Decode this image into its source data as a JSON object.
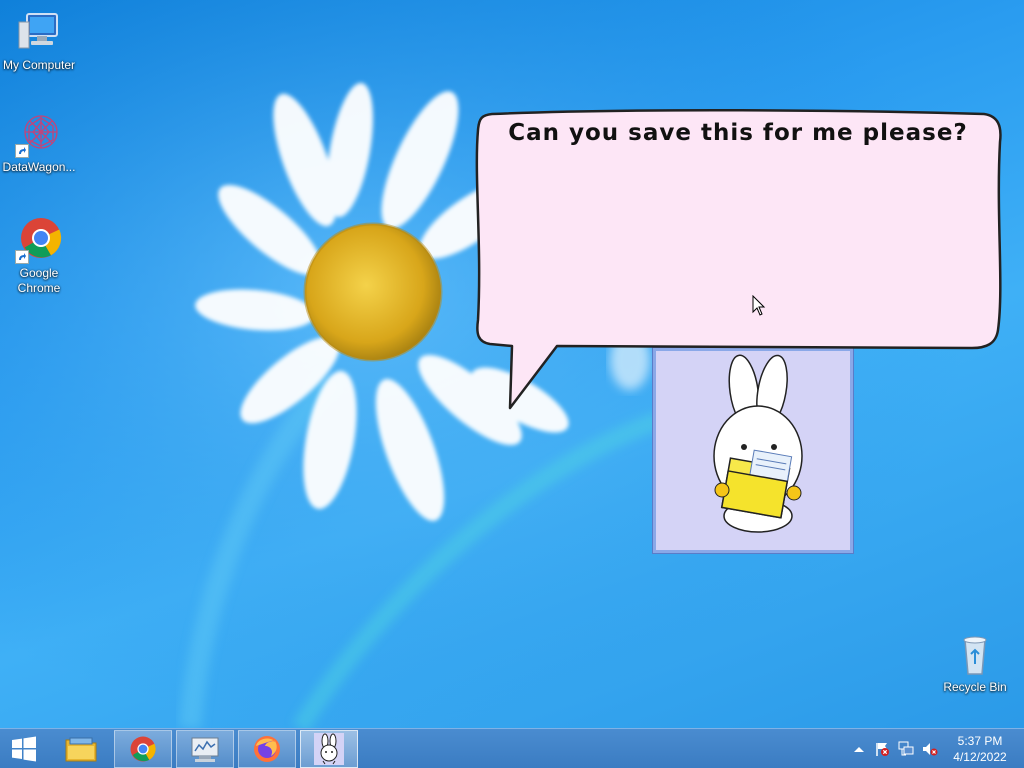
{
  "desktop": {
    "icons": [
      {
        "label": "My Computer"
      },
      {
        "label": "DataWagon..."
      },
      {
        "label": "Google Chrome"
      },
      {
        "label": "Recycle Bin"
      }
    ]
  },
  "assistant": {
    "speech": "Can you save this for me please?",
    "character": "bunny holding yellow folder"
  },
  "taskbar": {
    "start_icon": "windows-logo-icon",
    "apps": [
      {
        "name": "file-explorer-icon"
      },
      {
        "name": "chrome-icon"
      },
      {
        "name": "datawagon-icon"
      },
      {
        "name": "firefox-icon"
      },
      {
        "name": "bunny-agent-icon"
      }
    ]
  },
  "tray": {
    "time": "5:37 PM",
    "date": "4/12/2022",
    "icons": [
      "show-hidden-icon",
      "action-center-flag-icon",
      "network-icon",
      "volume-muted-icon"
    ]
  },
  "colors": {
    "accent": "#2a9cf0",
    "bubble_fill": "#fde6f6",
    "agent_bg": "#d4d3f6",
    "taskbar": "#3b7cc2"
  }
}
